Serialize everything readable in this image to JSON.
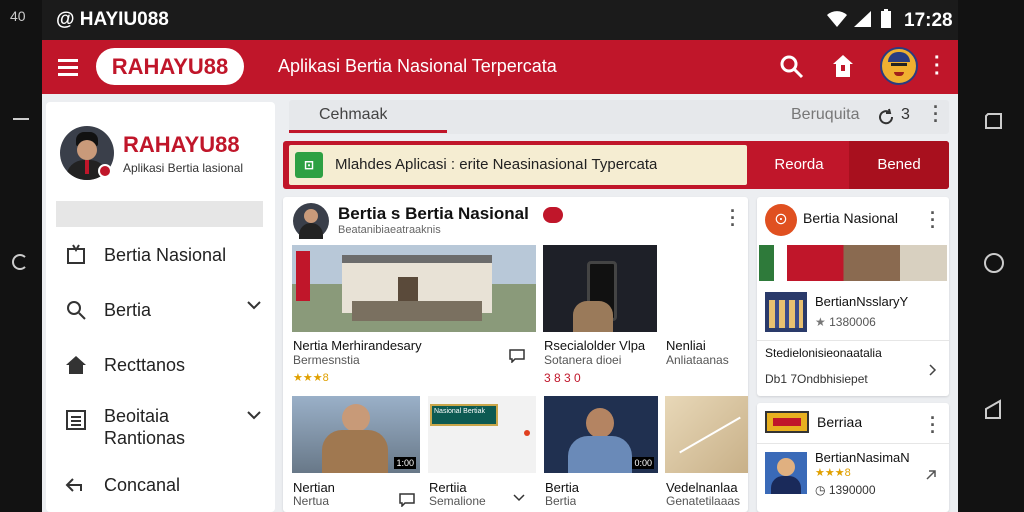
{
  "status": {
    "left": "40",
    "app_name": "@ HAYIU088",
    "time": "17:28"
  },
  "appbar": {
    "logo": "RAHAYU88",
    "tagline": "Aplikasi Bertia Nasional Terpercata"
  },
  "sidebar": {
    "profile_name": "RAHAYU88",
    "profile_sub": "Aplikasi Bertia lasional",
    "items": [
      {
        "label": "Bertia Nasional",
        "icon": "bookmark-icon"
      },
      {
        "label": "Bertia",
        "icon": "search-icon"
      },
      {
        "label": "Recttanos",
        "icon": "home-icon"
      },
      {
        "label": "Beoitaia",
        "label2": "Rantionas",
        "icon": "list-icon"
      },
      {
        "label": "Concanal",
        "icon": "back-arrow-icon"
      }
    ]
  },
  "search": {
    "placeholder": "Cehmaak",
    "right_label": "Beruquita",
    "count": "3"
  },
  "banner": {
    "text": "Mlahdes Aplicasi :  erite NeasinasionaI Typercata",
    "btn1": "Reorda",
    "btn2": "Bened"
  },
  "main_card": {
    "title": "Bertia s Bertia Nasional",
    "subtitle": "Beatanibiaeatraaknis",
    "tiles": [
      {
        "line1": "Nertia Merhirandesary",
        "line2": "Bermesnstia",
        "rating": "★★★8"
      },
      {
        "line1": "Rsecialolder Vlpa",
        "line2": "Sotanera dioei",
        "rating": "3 8 3 0"
      },
      {
        "line1": "Nenliai",
        "line2": "Anliataanas",
        "rating": ""
      },
      {
        "line1": "Nertian",
        "line2": "Nertua",
        "rating": "",
        "badge": "1:00"
      },
      {
        "line1": "Rertiia",
        "line2": "Semalione",
        "rating": "",
        "ticker": "Nasional Bertiak"
      },
      {
        "line1": "Bertia",
        "line2": "Bertia",
        "rating": "",
        "badge": "0:00"
      },
      {
        "line1": "Vedelnanlaa",
        "line2": "Genatetilaaas",
        "rating": ""
      }
    ]
  },
  "right_card1": {
    "title": "Bertia Nasional",
    "item_title": "BertianNsslaryY",
    "item_meta": "1380006",
    "link1": "Stedielonisieonaatalia",
    "link2": "Db1 7Ondbhisiepet"
  },
  "right_card2": {
    "title": "Berriaa",
    "item_title": "BertianNasimaN",
    "item_meta": "1390000",
    "rating": "★★★8"
  }
}
